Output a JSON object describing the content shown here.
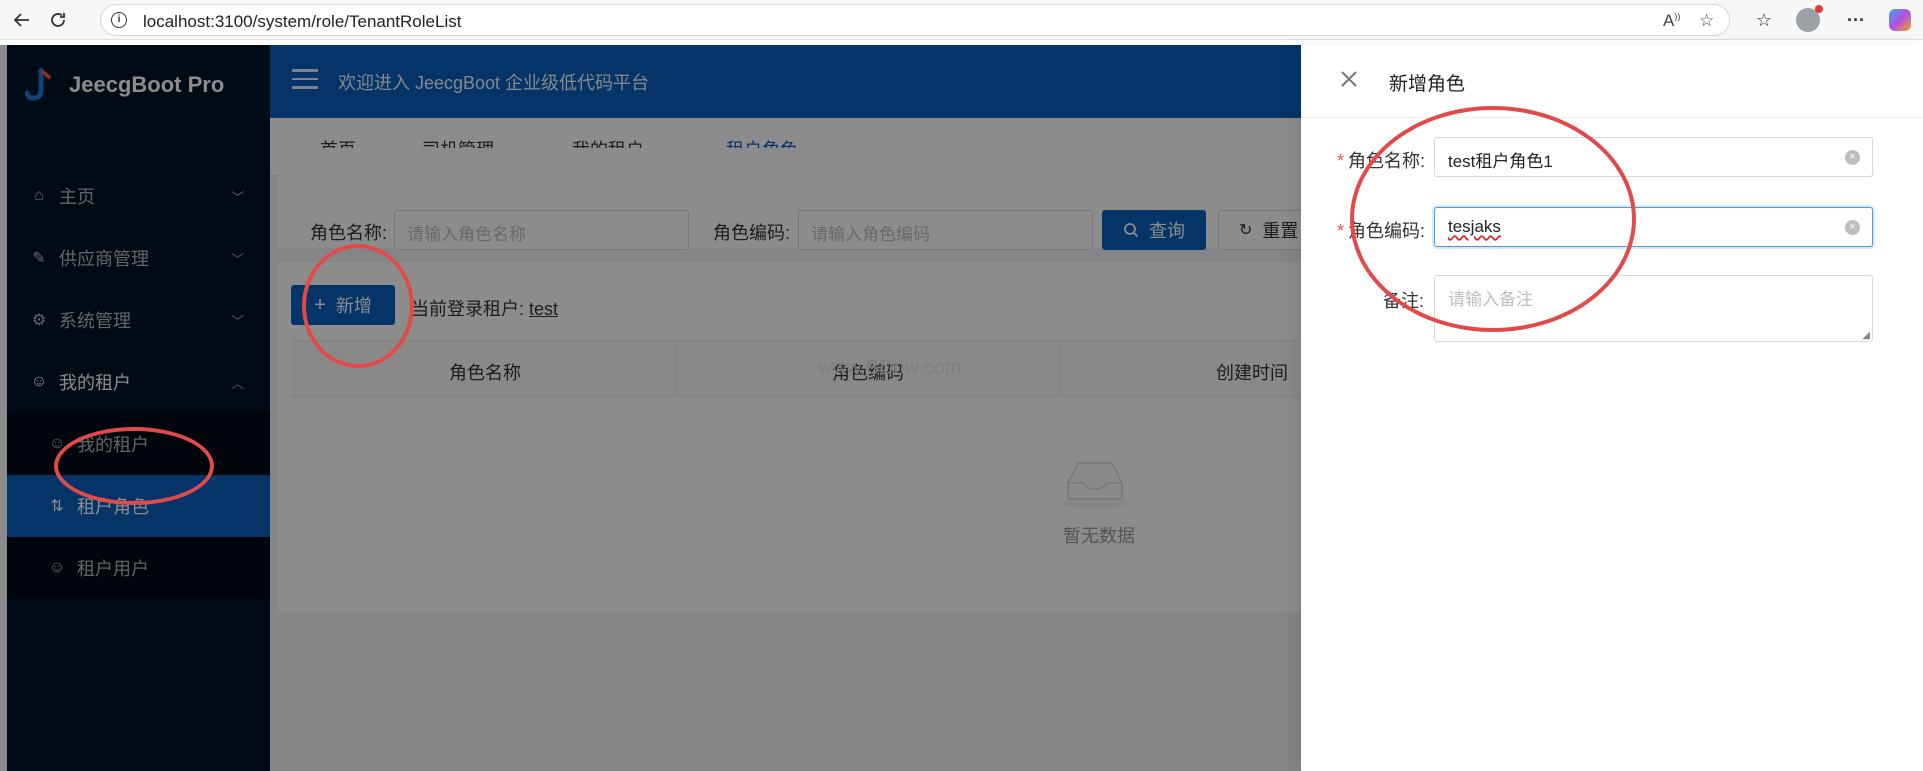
{
  "browser": {
    "url": "localhost:3100/system/role/TenantRoleList",
    "back_icon": "back-arrow-icon",
    "refresh_icon": "refresh-icon"
  },
  "app": {
    "title": "JeecgBoot Pro",
    "welcome": "欢迎进入 JeecgBoot 企业级低代码平台",
    "accent": "#0960bd",
    "sidebar_bg": "#001529"
  },
  "sidebar": {
    "items": [
      {
        "label": "主页",
        "icon": "home-icon"
      },
      {
        "label": "供应商管理",
        "icon": "supplier-icon"
      },
      {
        "label": "系统管理",
        "icon": "gear-icon"
      },
      {
        "label": "我的租户",
        "icon": "user-icon"
      }
    ],
    "sub_items": [
      {
        "label": "我的租户",
        "icon": "user-icon"
      },
      {
        "label": "租户角色",
        "icon": "role-icon"
      },
      {
        "label": "租户用户",
        "icon": "user-icon"
      }
    ]
  },
  "tabs": [
    "首页",
    "司机管理",
    "我的租户",
    "租户角色"
  ],
  "search": {
    "role_name_label": "角色名称:",
    "role_name_placeholder": "请输入角色名称",
    "role_code_label": "角色编码:",
    "role_code_placeholder": "请输入角色编码",
    "query_label": "查询",
    "reset_label": "重置"
  },
  "table": {
    "add_label": "新增",
    "tenant_prefix": "当前登录租户:",
    "tenant_name": "test",
    "columns": [
      "角色名称",
      "角色编码",
      "创建时间"
    ],
    "empty_text": "暂无数据",
    "watermark": "www.BDnw.com"
  },
  "drawer": {
    "title": "新增角色",
    "fields": {
      "role_name_label": "角色名称:",
      "role_name_value": "test租户角色1",
      "role_code_label": "角色编码:",
      "role_code_value": "tesjaks",
      "remark_label": "备注:",
      "remark_placeholder": "请输入备注"
    }
  }
}
